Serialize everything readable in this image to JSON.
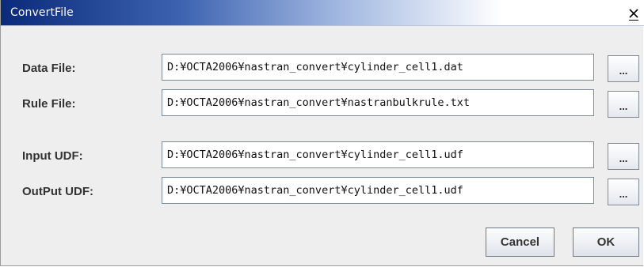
{
  "window": {
    "title": "ConvertFile",
    "close_icon": "close-x-icon"
  },
  "rows": [
    {
      "label": "Data File:",
      "value": "D:¥OCTA2006¥nastran_convert¥cylinder_cell1.dat",
      "browse_label": "..."
    },
    {
      "label": "Rule File:",
      "value": "D:¥OCTA2006¥nastran_convert¥nastranbulkrule.txt",
      "browse_label": "..."
    },
    {
      "label": "Input UDF:",
      "value": "D:¥OCTA2006¥nastran_convert¥cylinder_cell1.udf",
      "browse_label": "..."
    },
    {
      "label": "OutPut UDF:",
      "value": "D:¥OCTA2006¥nastran_convert¥cylinder_cell1.udf",
      "browse_label": "..."
    }
  ],
  "actions": {
    "cancel_label": "Cancel",
    "ok_label": "OK"
  }
}
